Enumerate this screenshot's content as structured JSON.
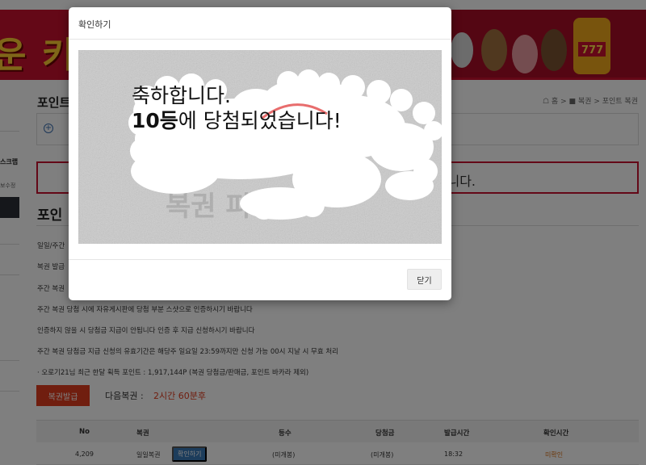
{
  "header": {
    "banner_text": "운 키",
    "colors": {
      "brand_red": "#c8102e",
      "banner_gold": "#ffcc33"
    }
  },
  "breadcrumb": {
    "home": "홈",
    "section": "복권",
    "current": "포인트 복권"
  },
  "page": {
    "title": "포인트",
    "subtitle": "포인",
    "notice_tail": "니다.",
    "info_lines": [
      "일일/주간",
      "복권 발급",
      "주간 복권",
      "주간 복권 당첨 시에 자유게시판에 당첨 부분 스샷으로 인증하시기 바랍니다",
      "인증하지 않을 시 당첨금 지급이 안됩니다 인증 후 지급 신청하시기 바랍니다",
      "주간 복권 당첨금 지급 신청의 유효기간은 해당주 일요일 23:59까지만 신청 가능 00시 지날 시 무효 처리",
      "· 오로기21님 최근 한달 획득 포인트 : 1,917,144P (복권 당첨금/판매금, 포인트 바카라 제외)"
    ]
  },
  "sidebar": {
    "label": "스크랩",
    "sub": "보수정"
  },
  "actions": {
    "issue_button": "복권발급",
    "next_label": "다음복권 :",
    "next_time": "2시간 60분후"
  },
  "table": {
    "headers": [
      "No",
      "복권",
      "등수",
      "당첨금",
      "발급시간",
      "확인시간"
    ],
    "rows": [
      {
        "no": "4,209",
        "type": "일일복권",
        "confirm_btn": "확인하기",
        "rank": "(미개봉)",
        "prize": "(미개봉)",
        "issued": "18:32",
        "checked": "미확인"
      }
    ]
  },
  "modal": {
    "title": "확인하기",
    "win_line1": "축하합니다.",
    "win_rank": "10등",
    "win_line2_rest": "에 당첨되었습니다!",
    "close_button": "닫기"
  }
}
